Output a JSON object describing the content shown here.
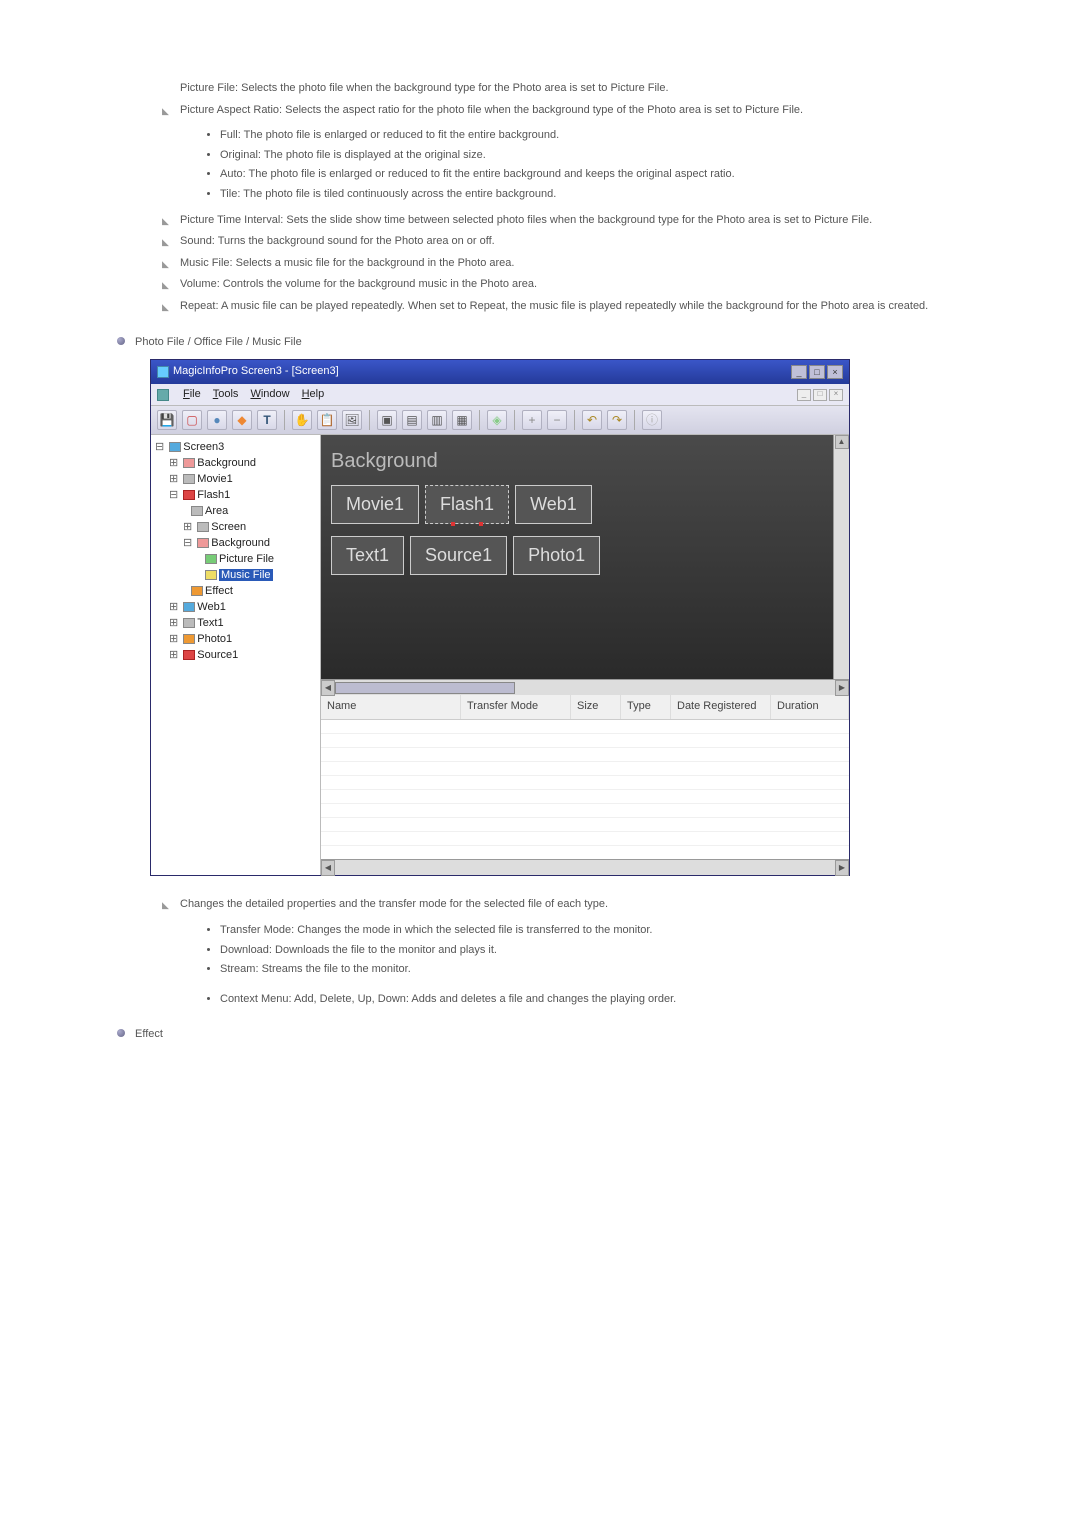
{
  "intro": {
    "pictureFile": "Picture File: Selects the photo file when the background type for the Photo area is set to Picture File.",
    "pictureAspect": "Picture Aspect Ratio: Selects the aspect ratio for the photo file when the background type of the Photo area is set to Picture File.",
    "aspects": {
      "full": "Full: The photo file is enlarged or reduced to fit the entire background.",
      "original": "Original: The photo file is displayed at the original size.",
      "auto": "Auto: The photo file is enlarged or reduced to fit the entire background and keeps the original aspect ratio.",
      "tile": "Tile: The photo file is tiled continuously across the entire background."
    },
    "timeInterval": "Picture Time Interval: Sets the slide show time between selected photo files when the background type for the Photo area is set to Picture File.",
    "sound": "Sound: Turns the background sound for the Photo area on or off.",
    "musicFile": "Music File: Selects a music file for the background in the Photo area.",
    "volume": "Volume: Controls the volume for the background music in the Photo area.",
    "repeat": "Repeat: A music file can be played repeatedly. When set to Repeat, the music file is played repeatedly while the background for the Photo area is created."
  },
  "sectionHeading": "Photo File / Office File / Music File",
  "app": {
    "title": "MagicInfoPro Screen3 - [Screen3]",
    "menus": {
      "file": "File",
      "tools": "Tools",
      "window": "Window",
      "help": "Help"
    },
    "tree": {
      "root": "Screen3",
      "background": "Background",
      "movie1": "Movie1",
      "flash1": "Flash1",
      "area": "Area",
      "screen": "Screen",
      "bg2": "Background",
      "pictureFile": "Picture File",
      "musicFile": "Music File",
      "effect": "Effect",
      "web1": "Web1",
      "text1": "Text1",
      "photo1": "Photo1",
      "source1": "Source1"
    },
    "canvas": {
      "bgLabel": "Background",
      "zones": {
        "movie1": "Movie1",
        "flash1": "Flash1",
        "web1": "Web1",
        "text1": "Text1",
        "source1": "Source1",
        "photo1": "Photo1"
      }
    },
    "columns": {
      "name": "Name",
      "transferMode": "Transfer Mode",
      "size": "Size",
      "type": "Type",
      "dateRegistered": "Date Registered",
      "duration": "Duration"
    }
  },
  "below": {
    "changes": "Changes the detailed properties and the transfer mode for the selected file of each type.",
    "items": {
      "transferMode": "Transfer Mode: Changes the mode in which the selected file is transferred to the monitor.",
      "download": "Download: Downloads the file to the monitor and plays it.",
      "stream": "Stream: Streams the file to the monitor.",
      "contextMenu": "Context Menu: Add, Delete, Up, Down: Adds and deletes a file and changes the playing order."
    }
  },
  "effectHeading": "Effect"
}
